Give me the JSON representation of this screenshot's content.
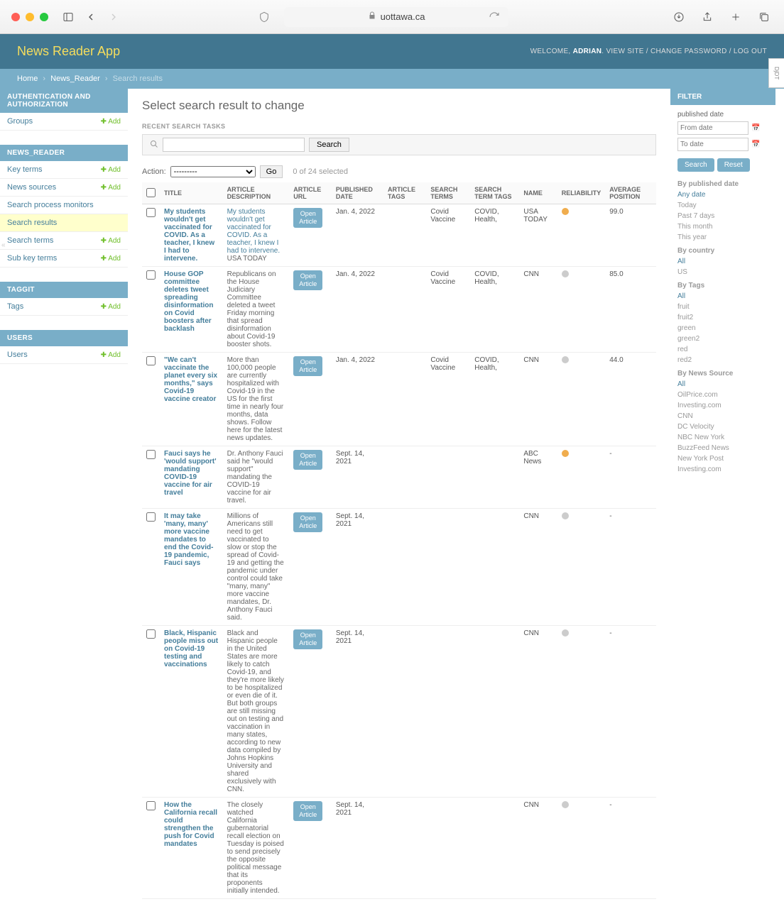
{
  "browser": {
    "domain": "uottawa.ca"
  },
  "header": {
    "app_title": "News Reader App",
    "welcome": "WELCOME,",
    "username": "ADRIAN",
    "view_site": "VIEW SITE",
    "change_password": "CHANGE PASSWORD",
    "logout": "LOG OUT"
  },
  "breadcrumb": {
    "home": "Home",
    "section": "News_Reader",
    "current": "Search results"
  },
  "sidebar": {
    "auth": {
      "header": "AUTHENTICATION AND AUTHORIZATION",
      "items": [
        {
          "label": "Groups",
          "add": "Add"
        }
      ]
    },
    "news": {
      "header": "NEWS_READER",
      "items": [
        {
          "label": "Key terms",
          "add": "Add"
        },
        {
          "label": "News sources",
          "add": "Add"
        },
        {
          "label": "Search process monitors",
          "add": ""
        },
        {
          "label": "Search results",
          "add": "",
          "highlight": true
        },
        {
          "label": "Search terms",
          "add": "Add"
        },
        {
          "label": "Sub key terms",
          "add": "Add"
        }
      ]
    },
    "taggit": {
      "header": "TAGGIT",
      "items": [
        {
          "label": "Tags",
          "add": "Add"
        }
      ]
    },
    "users": {
      "header": "USERS",
      "items": [
        {
          "label": "Users",
          "add": "Add"
        }
      ]
    }
  },
  "content": {
    "page_title": "Select search result to change",
    "recent_tasks": "RECENT SEARCH TASKS",
    "search_button": "Search",
    "action_label": "Action:",
    "action_default": "---------",
    "go": "Go",
    "selection_count": "0 of 24 selected",
    "columns": {
      "title": "TITLE",
      "desc": "ARTICLE DESCRIPTION",
      "url": "ARTICLE URL",
      "pubdate": "PUBLISHED DATE",
      "tags": "ARTICLE TAGS",
      "sterms": "SEARCH TERMS",
      "stags": "SEARCH TERM TAGS",
      "name": "NAME",
      "reliability": "RELIABILITY",
      "avgpos": "AVERAGE POSITION"
    },
    "open_article": "Open Article",
    "rows": [
      {
        "title": "My students wouldn't get vaccinated for COVID. As a teacher, I knew I had to intervene.",
        "desc_lead": "My students wouldn't get vaccinated for COVID. As a teacher, I knew I had to intervene.",
        "desc_src": "USA TODAY",
        "date": "Jan. 4, 2022",
        "sterms": "Covid Vaccine",
        "stags": "COVID, Health,",
        "name": "USA TODAY",
        "rel": "yellow",
        "pos": "99.0"
      },
      {
        "title": "House GOP committee deletes tweet spreading disinformation on Covid boosters after backlash",
        "desc": "Republicans on the House Judiciary Committee deleted a tweet Friday morning that spread disinformation about Covid-19 booster shots.",
        "date": "Jan. 4, 2022",
        "sterms": "Covid Vaccine",
        "stags": "COVID, Health,",
        "name": "CNN",
        "rel": "gray",
        "pos": "85.0"
      },
      {
        "title": "\"We can't vaccinate the planet every six months,\" says Covid-19 vaccine creator",
        "desc": "More than 100,000 people are currently hospitalized with Covid-19 in the US for the first time in nearly four months, data shows. Follow here for the latest news updates.",
        "date": "Jan. 4, 2022",
        "sterms": "Covid Vaccine",
        "stags": "COVID, Health,",
        "name": "CNN",
        "rel": "gray",
        "pos": "44.0"
      },
      {
        "title": "Fauci says he 'would support' mandating COVID-19 vaccine for air travel",
        "desc": "Dr. Anthony Fauci said he \"would support\" mandating the COVID-19 vaccine for air travel.",
        "date": "Sept. 14, 2021",
        "sterms": "",
        "stags": "",
        "name": "ABC News",
        "rel": "yellow",
        "pos": "-"
      },
      {
        "title": "It may take 'many, many' more vaccine mandates to end the Covid-19 pandemic, Fauci says",
        "desc": "Millions of Americans still need to get vaccinated to slow or stop the spread of Covid-19 and getting the pandemic under control could take \"many, many\" more vaccine mandates, Dr. Anthony Fauci said.",
        "date": "Sept. 14, 2021",
        "sterms": "",
        "stags": "",
        "name": "CNN",
        "rel": "gray",
        "pos": "-"
      },
      {
        "title": "Black, Hispanic people miss out on Covid-19 testing and vaccinations",
        "desc": "Black and Hispanic people in the United States are more likely to catch Covid-19, and they're more likely to be hospitalized or even die of it. But both groups are still missing out on testing and vaccination in many states, according to new data compiled by Johns Hopkins University and shared exclusively with CNN.",
        "date": "Sept. 14, 2021",
        "sterms": "",
        "stags": "",
        "name": "CNN",
        "rel": "gray",
        "pos": "-"
      },
      {
        "title": "How the California recall could strengthen the push for Covid mandates",
        "desc": "The closely watched California gubernatorial recall election on Tuesday is poised to send precisely the opposite political message that its proponents initially intended.",
        "date": "Sept. 14, 2021",
        "sterms": "",
        "stags": "",
        "name": "CNN",
        "rel": "gray",
        "pos": "-"
      }
    ]
  },
  "filter": {
    "header": "FILTER",
    "pubdate_label": "published date",
    "from_placeholder": "From date",
    "to_placeholder": "To date",
    "search_btn": "Search",
    "reset_btn": "Reset",
    "by_pubdate": {
      "title": "By published date",
      "items": [
        "Any date",
        "Today",
        "Past 7 days",
        "This month",
        "This year"
      ],
      "active": 0
    },
    "by_country": {
      "title": "By country",
      "items": [
        "All",
        "US"
      ],
      "active": 0
    },
    "by_tags": {
      "title": "By Tags",
      "items": [
        "All",
        "fruit",
        "fruit2",
        "green",
        "green2",
        "red",
        "red2"
      ],
      "active": 0
    },
    "by_source": {
      "title": "By News Source",
      "items": [
        "All",
        "OilPrice.com",
        "Investing.com",
        "CNN",
        "DC Velocity",
        "NBC New York",
        "BuzzFeed News",
        "New York Post",
        "Investing.com"
      ],
      "active": 0
    }
  }
}
